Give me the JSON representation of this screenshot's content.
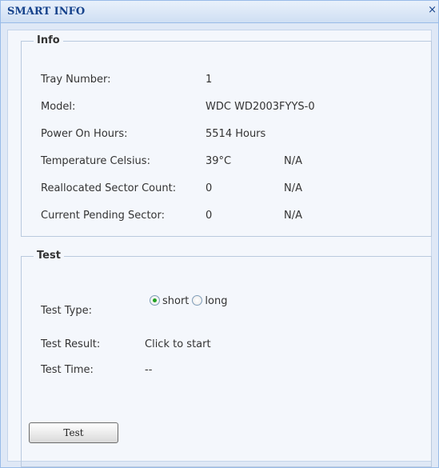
{
  "window": {
    "title": "SMART INFO",
    "close_glyph": "×"
  },
  "info": {
    "legend": "Info",
    "rows": [
      {
        "label": "Tray Number:",
        "value": "1",
        "status": ""
      },
      {
        "label": "Model:",
        "value": "WDC WD2003FYYS-0",
        "status": ""
      },
      {
        "label": "Power On Hours:",
        "value": "5514 Hours",
        "status": ""
      },
      {
        "label": "Temperature Celsius:",
        "value": "39°C",
        "status": "N/A"
      },
      {
        "label": "Reallocated Sector Count:",
        "value": "0",
        "status": "N/A"
      },
      {
        "label": "Current Pending Sector:",
        "value": "0",
        "status": "N/A"
      }
    ]
  },
  "test": {
    "legend": "Test",
    "type_label": "Test Type:",
    "options": [
      {
        "label": "short",
        "checked": true
      },
      {
        "label": "long",
        "checked": false
      }
    ],
    "result_label": "Test Result:",
    "result_value": "Click to start",
    "time_label": "Test Time:",
    "time_value": "--",
    "button_label": "Test"
  },
  "colors": {
    "title_text": "#15428b",
    "window_bg": "#dfe8f6",
    "panel_bg": "#f4f7fc",
    "radio_checked": "#21a121"
  }
}
